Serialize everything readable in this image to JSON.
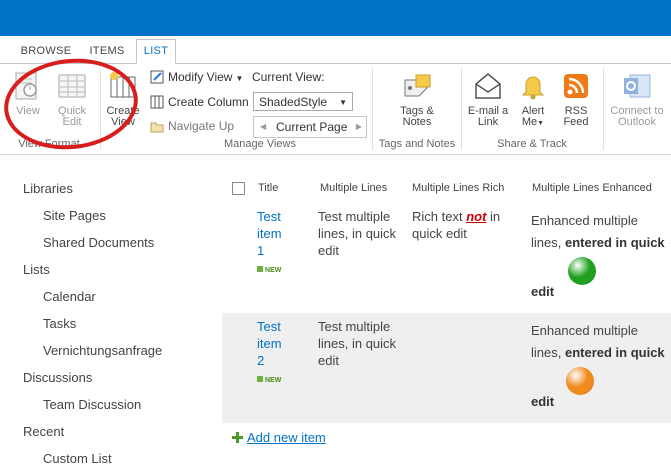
{
  "tabs": [
    {
      "label": "BROWSE"
    },
    {
      "label": "ITEMS"
    },
    {
      "label": "LIST"
    }
  ],
  "ribbon": {
    "view_format": {
      "label": "View Format",
      "view": "View",
      "quick_edit_1": "Quick",
      "quick_edit_2": "Edit"
    },
    "manage_views": {
      "label": "Manage Views",
      "create_view_1": "Create",
      "create_view_2": "View",
      "modify_view": "Modify View",
      "create_column": "Create Column",
      "navigate_up": "Navigate Up",
      "current_view_label": "Current View:",
      "current_view_value": "ShadedStyle",
      "current_page": "Current Page"
    },
    "tags_notes": {
      "label": "Tags and Notes",
      "button_1": "Tags &",
      "button_2": "Notes"
    },
    "share_track": {
      "label": "Share & Track",
      "email_1": "E-mail a",
      "email_2": "Link",
      "alert_1": "Alert",
      "alert_2": "Me",
      "rss_1": "RSS",
      "rss_2": "Feed"
    },
    "connect": {
      "connect_1": "Connect to",
      "connect_2": "Outlook"
    }
  },
  "nav": {
    "libraries": "Libraries",
    "site_pages": "Site Pages",
    "shared_documents": "Shared Documents",
    "lists": "Lists",
    "calendar": "Calendar",
    "tasks": "Tasks",
    "vernichtungsanfrage": "Vernichtungsanfrage",
    "discussions": "Discussions",
    "team_discussion": "Team Discussion",
    "recent": "Recent",
    "custom_list": "Custom List"
  },
  "list": {
    "headers": {
      "title": "Title",
      "multiple_lines": "Multiple Lines",
      "multiple_lines_rich": "Multiple Lines Rich",
      "multiple_lines_enhanced": "Multiple Lines Enhanced"
    },
    "new_badge": "NEW",
    "rows": [
      {
        "title_1": "Test",
        "title_2": "item",
        "title_3": "1",
        "ml_1": "Test multiple",
        "ml_2": "lines, in quick",
        "ml_3": "edit",
        "rich_1": "Rich text ",
        "rich_not": "not",
        "rich_2": " in",
        "rich_3": "quick edit",
        "enh_1": "Enhanced multiple",
        "enh_2a": "lines, ",
        "enh_2b": "entered in quick",
        "enh_3": "edit",
        "ball_color": "#1fa11f"
      },
      {
        "title_1": "Test",
        "title_2": "item",
        "title_3": "2",
        "ml_1": "Test multiple",
        "ml_2": "lines, in quick",
        "ml_3": "edit",
        "enh_1": "Enhanced multiple",
        "enh_2a": "lines, ",
        "enh_2b": "entered in quick",
        "enh_3": "edit",
        "ball_color": "#f08a1c"
      }
    ],
    "add_new_item": "Add new item"
  },
  "colors": {
    "brand": "#0072c6",
    "highlight_circle": "#d81d1d"
  }
}
